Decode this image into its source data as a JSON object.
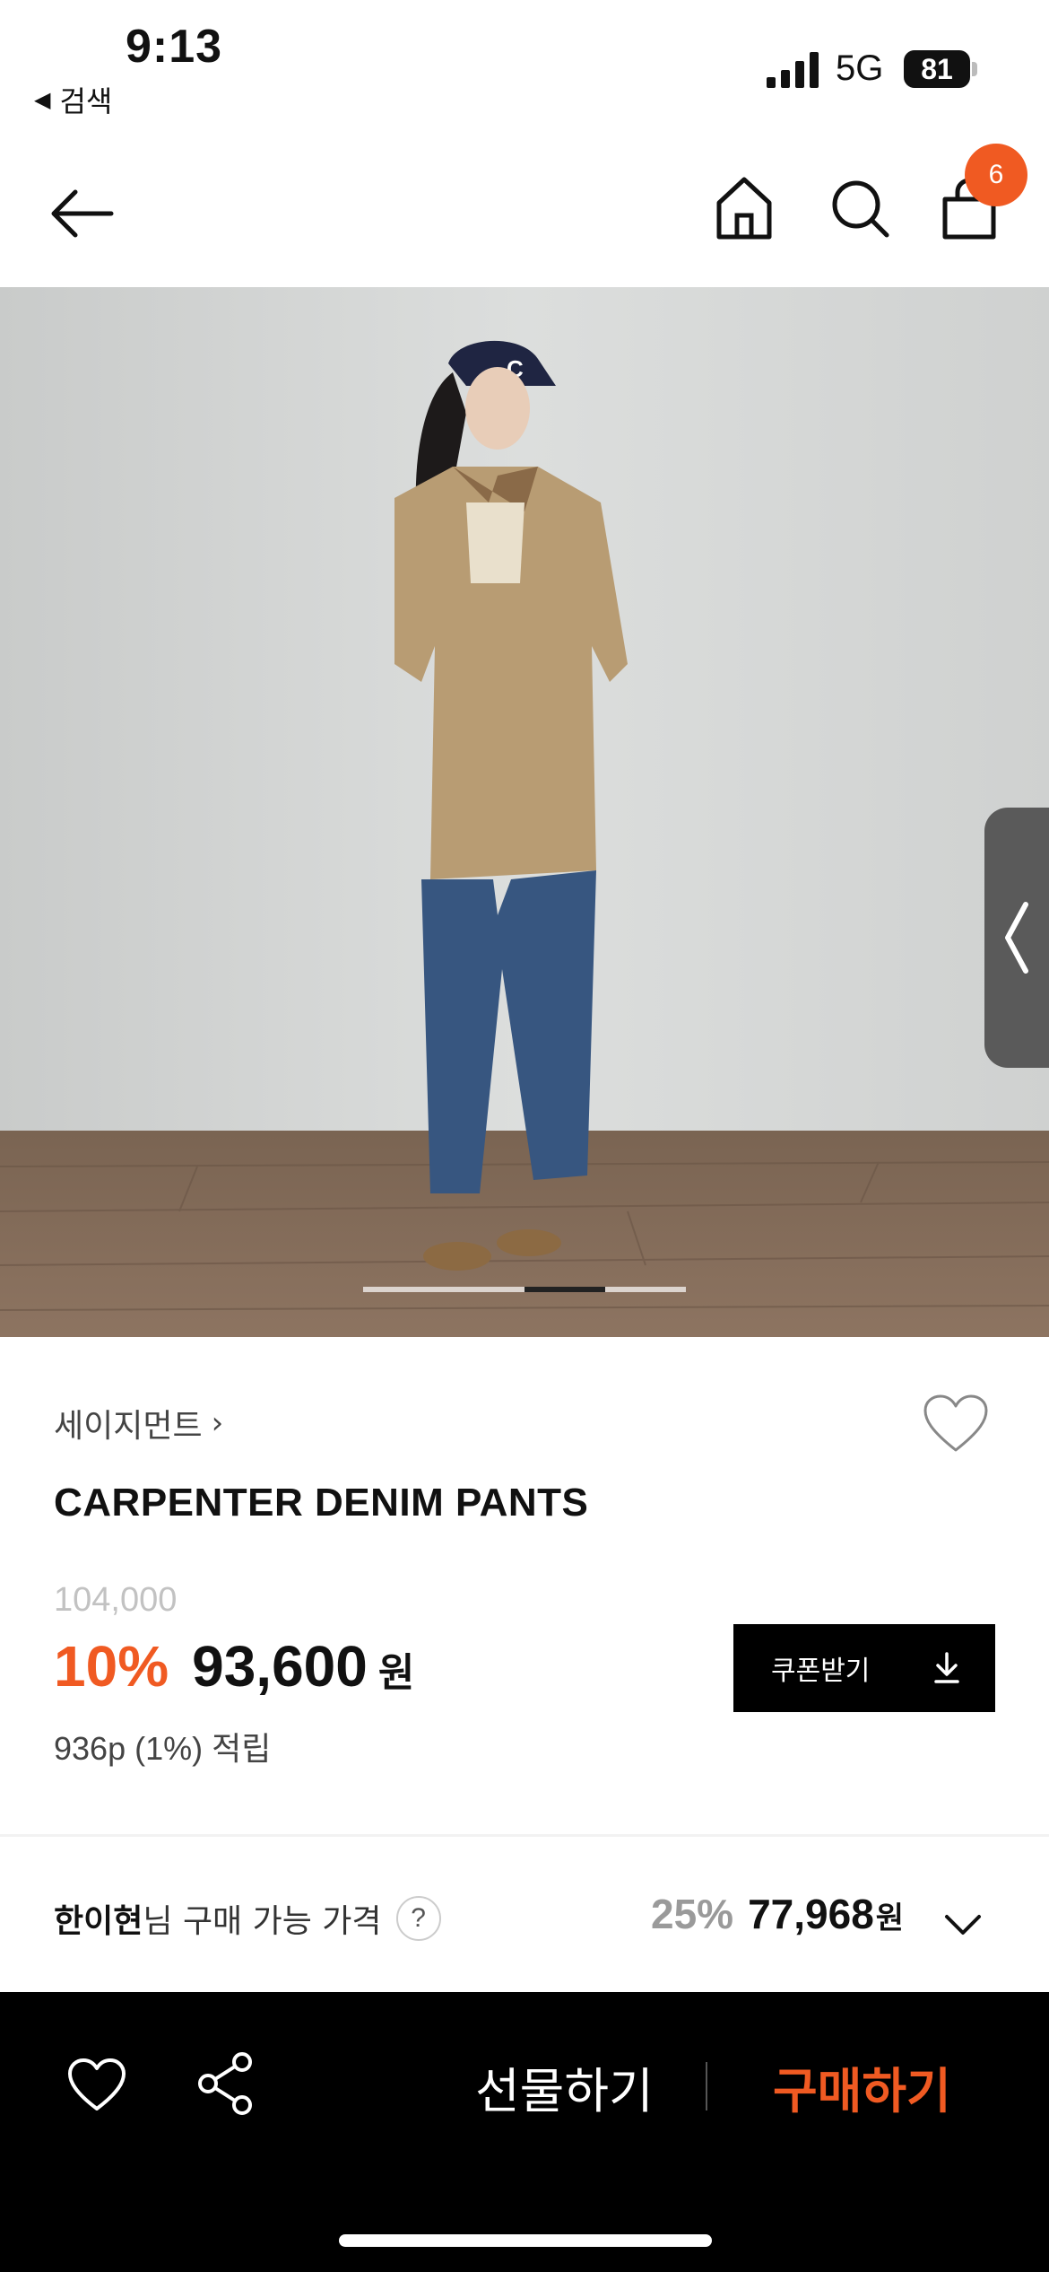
{
  "status_bar": {
    "time": "9:13",
    "back_to_app": "검색",
    "network": "5G",
    "battery": "81"
  },
  "nav": {
    "cart_count": "6",
    "icons": [
      "back-arrow-icon",
      "home-icon",
      "search-icon",
      "shopping-bag-icon"
    ]
  },
  "product": {
    "brand": "세이지먼트",
    "name": "CARPENTER DENIM PANTS",
    "original_price": "104,000",
    "discount": "10%",
    "sale_price": "93,600",
    "currency": "원",
    "points": "936p (1%) 적립",
    "coupon_button": "쿠폰받기"
  },
  "gallery": {
    "active_index": 3,
    "total": 4
  },
  "member_price": {
    "name": "한이현",
    "label_suffix": "님 구매 가능 가격",
    "help": "?",
    "discount": "25%",
    "amount": "77,968",
    "currency": "원"
  },
  "bottom_bar": {
    "gift": "선물하기",
    "buy": "구매하기"
  },
  "colors": {
    "accent": "#f05a22",
    "black": "#000000",
    "muted": "#c2c2c2"
  }
}
